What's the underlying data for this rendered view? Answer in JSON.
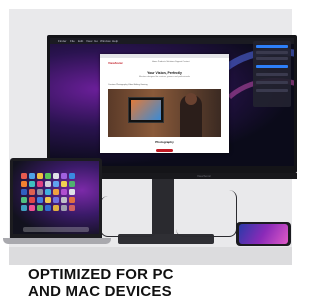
{
  "headline": "OPTIMIZED FOR PC\nAND MAC DEVICES",
  "monitor": {
    "brand_logo": "ViewSonic",
    "menubar_items": [
      "Finder",
      "File",
      "Edit",
      "View",
      "Go",
      "Window",
      "Help"
    ],
    "website": {
      "logo": "ViewSonic",
      "nav": "Home  Products  Solutions  Support  Contact",
      "title": "Your Vision, Perfectly",
      "subtitle": "Monitors designed for creators, gamers and professionals",
      "tabs": "Creators    Photography    Video Editing    Gaming",
      "section_title": "Photography",
      "section_text": "Color accurate displays designed to bring your creative vision to life."
    }
  },
  "colors": {
    "brand_red": "#c01b25",
    "wallpaper_purple": "#6b1f9a",
    "backdrop": "#e9e9eb"
  }
}
